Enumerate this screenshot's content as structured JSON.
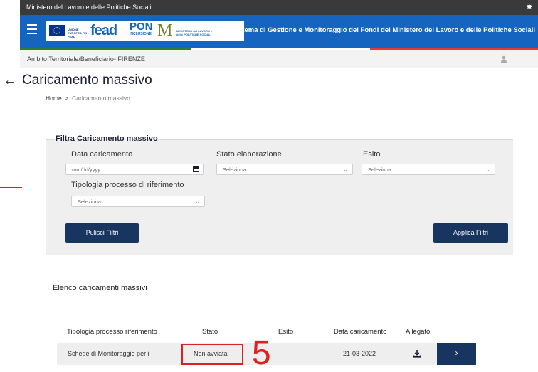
{
  "topbar": {
    "ministry": "Ministero del Lavoro e delle Politiche Sociali"
  },
  "navbar": {
    "title": "Sistema di Gestione e Monitoraggio dei Fondi del Ministero del Lavoro e delle Politiche Sociali",
    "logos": {
      "eu": "UNIONE EUROPEA FEI - FEAD",
      "fead": "fead",
      "pon": "PON",
      "pon_sub": "INCLUSIONE",
      "ministry_short": "MINISTERO del LAVORO e delle POLITICHE SOCIALI"
    }
  },
  "ambito": {
    "label": "Ambito Territoriale/Beneficiario- FIRENZE"
  },
  "page": {
    "title": "Caricamento massivo"
  },
  "breadcrumb": {
    "home": "Home",
    "separator": ">",
    "current": "Caricamento massivo"
  },
  "filter": {
    "legend": "Filtra Caricamento massivo",
    "data_caricamento": {
      "label": "Data caricamento",
      "placeholder": "mm/dd/yyyy"
    },
    "stato_elaborazione": {
      "label": "Stato elaborazione",
      "value": "Seleziona"
    },
    "esito": {
      "label": "Esito",
      "value": "Seleziona"
    },
    "tipologia": {
      "label": "Tipologia processo di riferimento",
      "value": "Seleziona"
    },
    "clear_button": "Pulisci Filtri",
    "apply_button": "Applica Filtri"
  },
  "list": {
    "title": "Elenco caricamenti massivi",
    "columns": [
      "Tipologia processo riferimento",
      "Stato",
      "Esito",
      "Data caricamento",
      "Allegato"
    ],
    "rows": [
      {
        "tipologia": "Schede di Monitoraggio per i",
        "stato": "Non avviata",
        "esito": "",
        "data": "21-03-2022"
      }
    ]
  },
  "annotation": {
    "number": "5",
    "color": "#e02020"
  },
  "icons": [
    "menu-icon",
    "gear-icon",
    "user-icon",
    "back-arrow-icon",
    "calendar-icon",
    "chevron-down-icon",
    "download-icon",
    "chevron-right-icon"
  ],
  "colors": {
    "navbar": "#1565c0",
    "button": "#17355f",
    "filter_bg": "#efefef"
  }
}
